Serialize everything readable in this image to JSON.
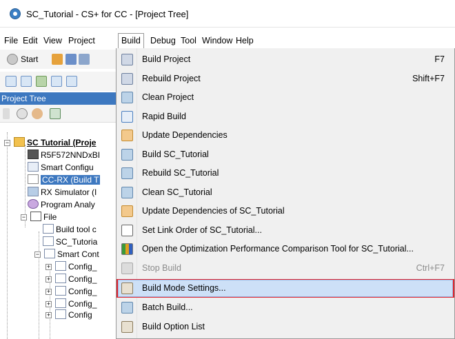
{
  "window": {
    "title": "SC_Tutorial - CS+ for CC - [Project Tree]"
  },
  "menubar": {
    "items": [
      "File",
      "Edit",
      "View",
      "Project",
      "Build",
      "Debug",
      "Tool",
      "Window",
      "Help"
    ],
    "active": "Build"
  },
  "toolbar": {
    "start_label": "Start"
  },
  "panel": {
    "title": "Project Tree"
  },
  "tree": {
    "root": "SC Tutorial (Proje",
    "items": [
      "R5F572NNDxBI",
      "Smart Configu",
      "CC-RX (Build T",
      "RX Simulator (I",
      "Program Analy",
      "File",
      "Build tool c",
      "SC_Tutoria",
      "Smart Cont",
      "Config_",
      "Config_",
      "Config_",
      "Config_",
      "Config"
    ]
  },
  "build_menu": {
    "items": [
      {
        "label": "Build Project",
        "shortcut": "F7",
        "icon": "build-project-icon"
      },
      {
        "label": "Rebuild Project",
        "shortcut": "Shift+F7",
        "icon": "rebuild-project-icon"
      },
      {
        "label": "Clean Project",
        "shortcut": "",
        "icon": "clean-project-icon"
      },
      {
        "label": "Rapid Build",
        "shortcut": "",
        "icon": "rapid-build-icon"
      },
      {
        "label": "Update Dependencies",
        "shortcut": "",
        "icon": "update-dependencies-icon"
      },
      {
        "label": "Build SC_Tutorial",
        "shortcut": "",
        "icon": "build-subproject-icon"
      },
      {
        "label": "Rebuild SC_Tutorial",
        "shortcut": "",
        "icon": "rebuild-subproject-icon"
      },
      {
        "label": "Clean SC_Tutorial",
        "shortcut": "",
        "icon": "clean-subproject-icon"
      },
      {
        "label": "Update Dependencies of SC_Tutorial",
        "shortcut": "",
        "icon": "update-subproject-dependencies-icon"
      },
      {
        "label": "Set Link Order of SC_Tutorial...",
        "shortcut": "",
        "icon": "link-order-icon"
      },
      {
        "label": "Open the Optimization Performance Comparison Tool for SC_Tutorial...",
        "shortcut": "",
        "icon": "optimization-chart-icon"
      },
      {
        "label": "Stop Build",
        "shortcut": "Ctrl+F7",
        "icon": "stop-build-icon"
      },
      {
        "label": "Build Mode Settings...",
        "shortcut": "",
        "icon": "build-mode-icon"
      },
      {
        "label": "Batch Build...",
        "shortcut": "",
        "icon": "batch-build-icon"
      },
      {
        "label": "Build Option List",
        "shortcut": "",
        "icon": "build-option-list-icon"
      }
    ],
    "highlighted": "Build Mode Settings...",
    "disabled": [
      "Stop Build"
    ],
    "highlight_border_color": "#e0202a",
    "highlight_fill_color": "#cde0f7"
  }
}
